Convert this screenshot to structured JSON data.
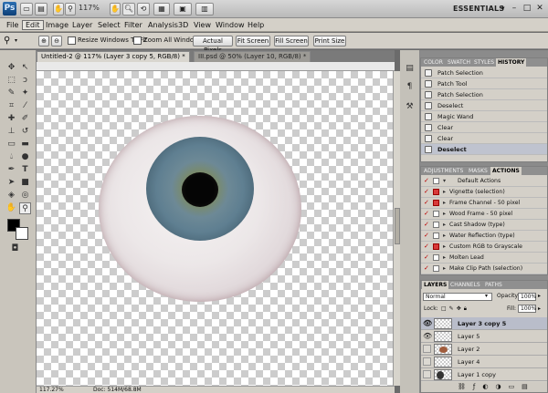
{
  "app": {
    "logo": "Ps",
    "zoom": "117%",
    "workspace": "ESSENTIALS",
    "window_controls": [
      "–",
      "□",
      "✕"
    ],
    "bar_icons": [
      "hand-icon",
      "zoom-icon",
      "rotate-icon",
      "grid-icon",
      "screen-mode-icon",
      "arrange-icon"
    ]
  },
  "menu": [
    "File",
    "Edit",
    "Image",
    "Layer",
    "Select",
    "Filter",
    "Analysis",
    "3D",
    "View",
    "Window",
    "Help"
  ],
  "menu_active": "Edit",
  "options": {
    "resize_windows": "Resize Windows To Fit",
    "zoom_all": "Zoom All Windows",
    "buttons": [
      "Actual Pixels",
      "Fit Screen",
      "Fill Screen",
      "Print Size"
    ]
  },
  "document": {
    "tabs": [
      {
        "label": "Untitled-2 @ 117% (Layer 3 copy 5, RGB/8) *",
        "active": true
      },
      {
        "label": "III.psd @ 50% (Layer 10, RGB/8) *",
        "active": false
      }
    ],
    "status_zoom": "117.27%",
    "status_doc": "Doc: 514M/68.8M"
  },
  "history_panel": {
    "tabs": [
      "COLOR",
      "SWATCH",
      "STYLES",
      "HISTORY"
    ],
    "active_tab": "HISTORY",
    "items": [
      {
        "label": "Patch Selection",
        "selected": false
      },
      {
        "label": "Patch Tool",
        "selected": false
      },
      {
        "label": "Patch Selection",
        "selected": false
      },
      {
        "label": "Deselect",
        "selected": false
      },
      {
        "label": "Magic Wand",
        "selected": false
      },
      {
        "label": "Clear",
        "selected": false
      },
      {
        "label": "Clear",
        "selected": false
      },
      {
        "label": "Deselect",
        "selected": true
      }
    ]
  },
  "actions_panel": {
    "tabs": [
      "ADJUSTMENTS",
      "MASKS",
      "ACTIONS"
    ],
    "active_tab": "ACTIONS",
    "set_name": "Default Actions",
    "items": [
      {
        "label": "Vignette (selection)",
        "red": true
      },
      {
        "label": "Frame Channel - 50 pixel",
        "red": true
      },
      {
        "label": "Wood Frame - 50 pixel",
        "red": false
      },
      {
        "label": "Cast Shadow (type)",
        "red": false
      },
      {
        "label": "Water Reflection (type)",
        "red": false
      },
      {
        "label": "Custom RGB to Grayscale",
        "red": true
      },
      {
        "label": "Molten Lead",
        "red": false
      },
      {
        "label": "Make Clip Path (selection)",
        "red": false
      }
    ]
  },
  "layers_panel": {
    "tabs": [
      "LAYERS",
      "CHANNELS",
      "PATHS"
    ],
    "active_tab": "LAYERS",
    "blend_mode": "Normal",
    "opacity_label": "Opacity:",
    "opacity": "100%",
    "lock_label": "Lock:",
    "fill_label": "Fill:",
    "fill": "100%",
    "layers": [
      {
        "name": "Layer 3 copy 5",
        "visible": true,
        "selected": true
      },
      {
        "name": "Layer 5",
        "visible": true,
        "selected": false
      },
      {
        "name": "Layer 2",
        "visible": false,
        "selected": false
      },
      {
        "name": "Layer 4",
        "visible": false,
        "selected": false
      },
      {
        "name": "Layer 1 copy",
        "visible": false,
        "selected": false
      }
    ]
  },
  "colors": {
    "accent": "#2c6fb2",
    "history_selected": "#bfc3cf",
    "action_red": "#d83a3a",
    "panel_bg": "#d4d0c8"
  }
}
